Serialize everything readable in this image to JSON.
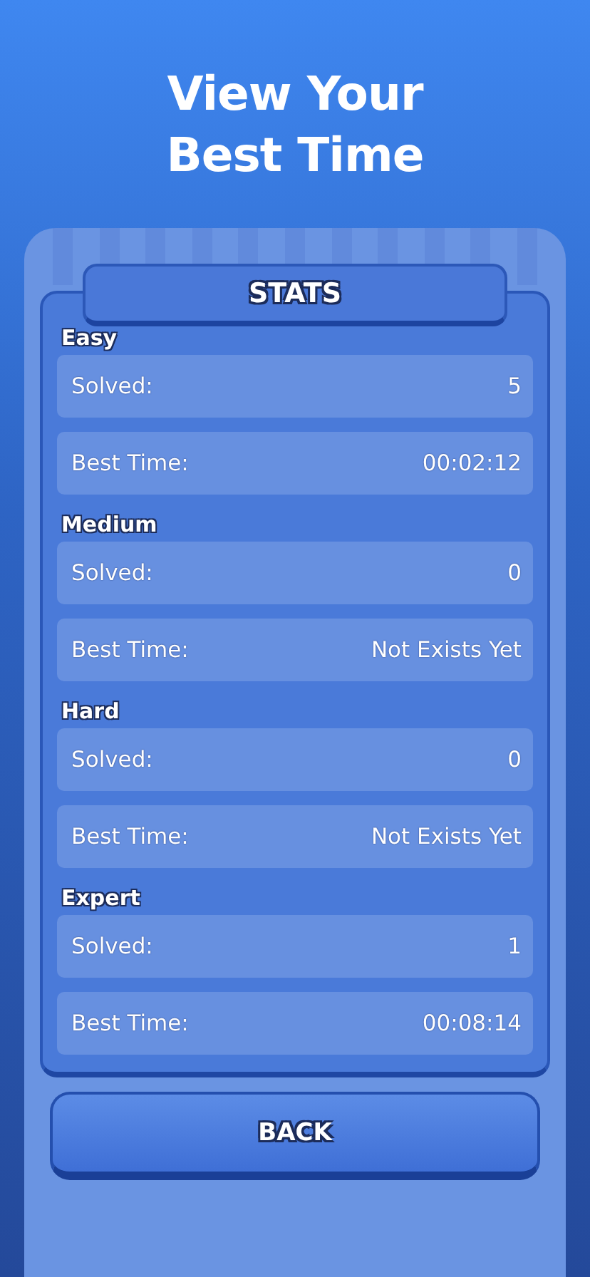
{
  "headline": [
    "View Your",
    "Best Time"
  ],
  "panel_title": "STATS",
  "sections": [
    {
      "title": "Easy",
      "rows": [
        {
          "label": "Solved:",
          "value": "5"
        },
        {
          "label": "Best Time:",
          "value": "00:02:12"
        }
      ]
    },
    {
      "title": "Medium",
      "rows": [
        {
          "label": "Solved:",
          "value": "0"
        },
        {
          "label": "Best Time:",
          "value": "Not Exists Yet"
        }
      ]
    },
    {
      "title": "Hard",
      "rows": [
        {
          "label": "Solved:",
          "value": "0"
        },
        {
          "label": "Best Time:",
          "value": "Not Exists Yet"
        }
      ]
    },
    {
      "title": "Expert",
      "rows": [
        {
          "label": "Solved:",
          "value": "1"
        },
        {
          "label": "Best Time:",
          "value": "00:08:14"
        }
      ]
    }
  ],
  "back_button": "BACK"
}
